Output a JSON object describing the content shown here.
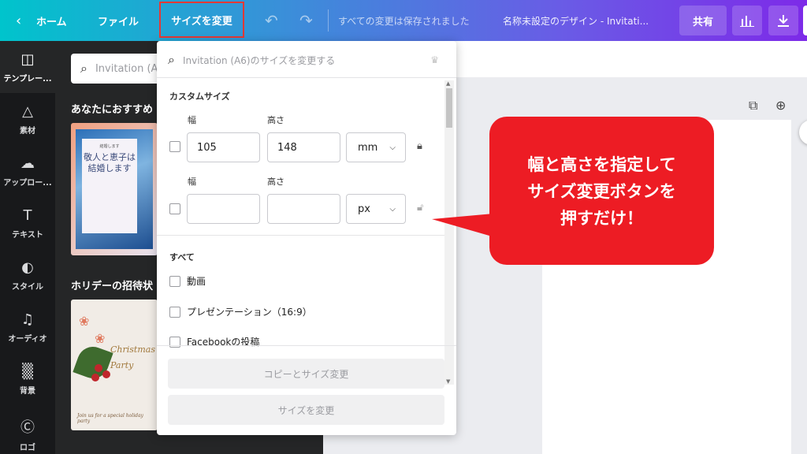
{
  "topbar": {
    "back_icon": "chevron-left-icon",
    "home": "ホーム",
    "file": "ファイル",
    "resize": "サイズを変更",
    "saved": "すべての変更は保存されました",
    "doc_name": "名称未設定のデザイン - Invitati...",
    "share": "共有",
    "highlight_color": "#e53935"
  },
  "sidebar": {
    "items": [
      {
        "label": "テンプレー...",
        "icon": "template-icon"
      },
      {
        "label": "素材",
        "icon": "elements-icon"
      },
      {
        "label": "アップロー...",
        "icon": "upload-icon"
      },
      {
        "label": "テキスト",
        "icon": "text-icon"
      },
      {
        "label": "スタイル",
        "icon": "palette-icon"
      },
      {
        "label": "オーディオ",
        "icon": "audio-icon"
      },
      {
        "label": "背景",
        "icon": "background-icon"
      },
      {
        "label": "ロゴ",
        "icon": "logo-icon"
      }
    ]
  },
  "panel": {
    "search_placeholder": "Invitation (A",
    "section1": "あなたにおすすめ",
    "section2": "ホリデーの招待状",
    "card1": {
      "small_top": "結婚します",
      "headline": "敬人と恵子は結婚します"
    },
    "card2": {
      "script": "Christmas Party",
      "bottom": "Join us for a special holiday party"
    }
  },
  "dropdown": {
    "search_placeholder": "Invitation (A6)のサイズを変更する",
    "custom_size": "カスタムサイズ",
    "row1": {
      "width_label": "幅",
      "height_label": "高さ",
      "width": "105",
      "height": "148",
      "unit": "mm"
    },
    "row2": {
      "width_label": "幅",
      "height_label": "高さ",
      "width": "",
      "height": "",
      "unit": "px"
    },
    "all": "すべて",
    "options": [
      "動画",
      "プレゼンテーション（16:9）",
      "Facebookの投稿"
    ],
    "copy_resize": "コピーとサイズ変更",
    "resize": "サイズを変更"
  },
  "callout": {
    "line1": "幅と高さを指定して",
    "line2": "サイズ変更ボタンを",
    "line3": "押すだけ！",
    "color": "#ed1c24"
  }
}
